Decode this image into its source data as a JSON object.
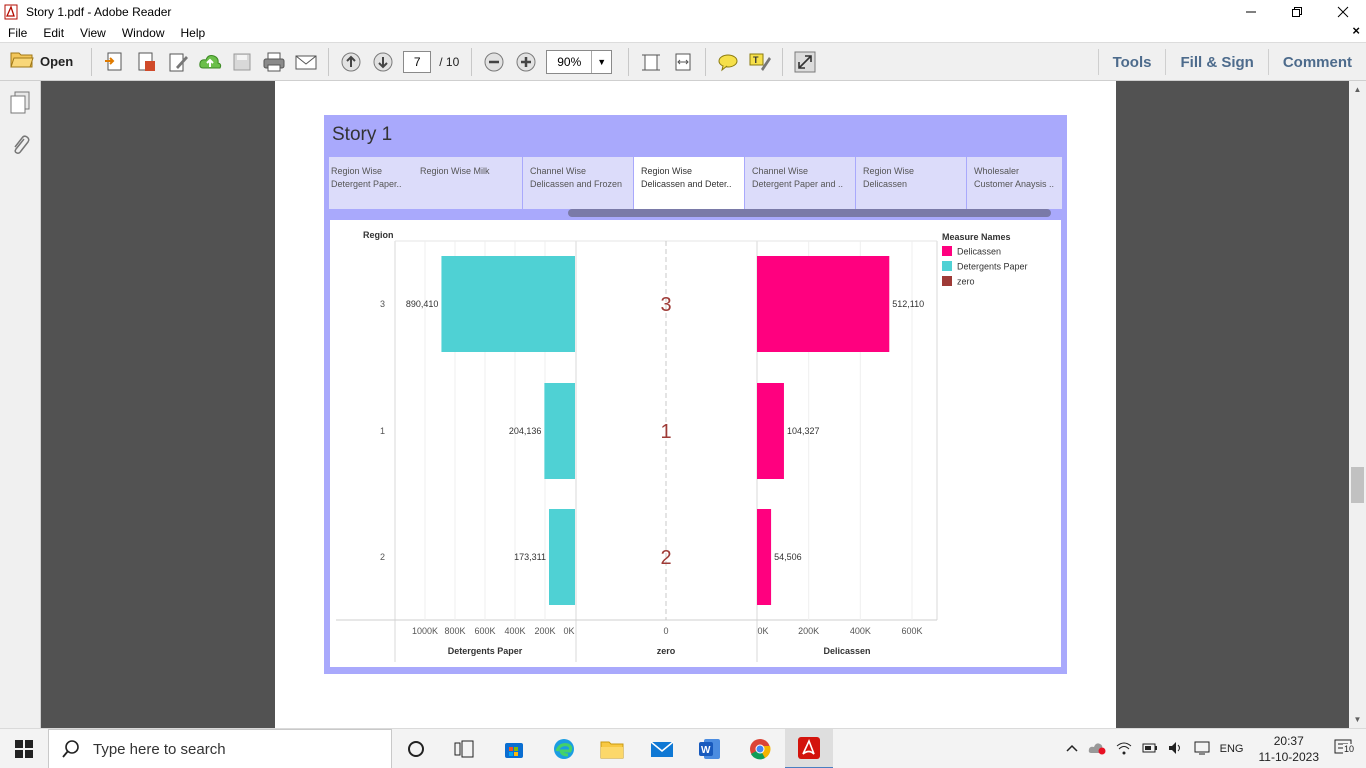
{
  "window": {
    "title": "Story 1.pdf - Adobe Reader",
    "controls": [
      "minimize",
      "restore",
      "close"
    ]
  },
  "menubar": {
    "items": [
      "File",
      "Edit",
      "View",
      "Window",
      "Help"
    ],
    "close": "×"
  },
  "toolbar": {
    "open_label": "Open",
    "page_current": "7",
    "page_total": "/ 10",
    "zoom": "90%",
    "right_tools": [
      "Tools",
      "Fill & Sign",
      "Comment"
    ]
  },
  "story": {
    "title": "Story 1",
    "tabs": [
      {
        "line1": "Region Wise",
        "line2": "Detergent Paper.."
      },
      {
        "line1": "Region Wise Milk",
        "line2": ""
      },
      {
        "line1": "Channel Wise",
        "line2": "Delicassen and Frozen"
      },
      {
        "line1": "Region Wise",
        "line2": "Delicassen and Deter.."
      },
      {
        "line1": "Channel Wise",
        "line2": "Detergent Paper and .."
      },
      {
        "line1": "Region Wise",
        "line2": "Delicassen"
      },
      {
        "line1": "Wholesaler",
        "line2": "Customer Anaysis .."
      }
    ],
    "active_tab": 3
  },
  "chart_data": {
    "type": "bar",
    "row_header": "Region",
    "categories": [
      "3",
      "1",
      "2"
    ],
    "series": [
      {
        "name": "Detergents Paper",
        "values": [
          890410,
          204136,
          173311
        ],
        "labels": [
          "890,410",
          "204,136",
          "173,311"
        ],
        "color": "#4fd1d4"
      },
      {
        "name": "zero",
        "values": [
          0,
          0,
          0
        ],
        "labels": [
          "3",
          "1",
          "2"
        ],
        "color": "#9e3a36"
      },
      {
        "name": "Delicassen",
        "values": [
          512110,
          104327,
          54506
        ],
        "labels": [
          "512,110",
          "104,327",
          "54,506"
        ],
        "color": "#ff007f"
      }
    ],
    "left_axis": {
      "title": "Detergents Paper",
      "ticks": [
        "1000K",
        "800K",
        "600K",
        "400K",
        "200K",
        "0K"
      ],
      "range": [
        0,
        1000000
      ],
      "reversed": true
    },
    "middle_axis": {
      "title": "zero",
      "ticks": [
        "0"
      ]
    },
    "right_axis": {
      "title": "Delicassen",
      "ticks": [
        "0K",
        "200K",
        "400K",
        "600K"
      ],
      "range": [
        0,
        600000
      ]
    },
    "legend": {
      "title": "Measure Names",
      "items": [
        {
          "label": "Delicassen",
          "color": "#ff007f"
        },
        {
          "label": "Detergents Paper",
          "color": "#4fd1d4"
        },
        {
          "label": "zero",
          "color": "#9e3a36"
        }
      ],
      "placement": "right"
    }
  },
  "taskbar": {
    "search_placeholder": "Type here to search",
    "apps": [
      "cortana",
      "task-view",
      "microsoft-store",
      "edge",
      "file-explorer",
      "mail",
      "word",
      "chrome",
      "adobe-reader"
    ],
    "language": "ENG",
    "time": "20:37",
    "date": "11-10-2023",
    "notification_count": "10"
  }
}
